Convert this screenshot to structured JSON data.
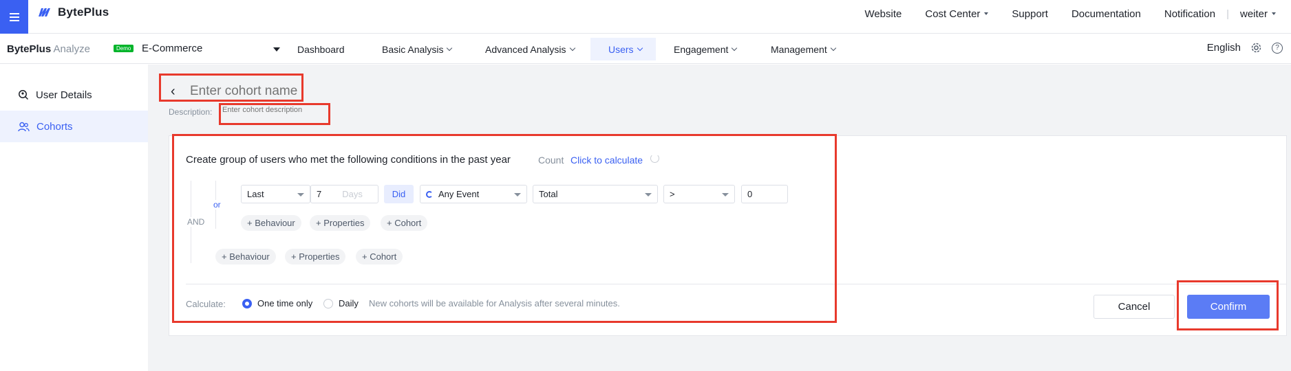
{
  "topbar": {
    "logo": "BytePlus",
    "links": [
      "Website",
      "Cost Center",
      "Support",
      "Documentation",
      "Notification"
    ],
    "user": "weiter"
  },
  "navbar": {
    "brand_bold": "BytePlus",
    "brand_light": "Analyze",
    "demo_badge": "Demo",
    "project": "E-Commerce",
    "items": [
      "Dashboard",
      "Basic Analysis",
      "Advanced Analysis",
      "Users",
      "Engagement",
      "Management"
    ],
    "language": "English"
  },
  "sidebar": {
    "items": [
      "User Details",
      "Cohorts"
    ]
  },
  "editor": {
    "name_placeholder": "Enter cohort name",
    "description_label": "Description:",
    "description_placeholder": "Enter cohort description",
    "title": "Create group of users who met the following conditions in the past year",
    "count_label": "Count",
    "count_link": "Click to calculate",
    "and_label": "AND",
    "or_label": "or",
    "condition": {
      "range": "Last",
      "number": "7",
      "unit": "Days",
      "did": "Did",
      "event": "Any Event",
      "measure": "Total",
      "operator": ">",
      "value": "0"
    },
    "add_buttons": [
      "+ Behaviour",
      "+ Properties",
      "+ Cohort"
    ],
    "calculate_label": "Calculate:",
    "calc_options": [
      "One time only",
      "Daily"
    ],
    "calc_note": "New cohorts will be available for Analysis after several minutes.",
    "cancel": "Cancel",
    "confirm": "Confirm"
  },
  "colors": {
    "brand": "#3a60f2",
    "confirm": "#5b7cf5",
    "annotation": "#e8392c"
  }
}
